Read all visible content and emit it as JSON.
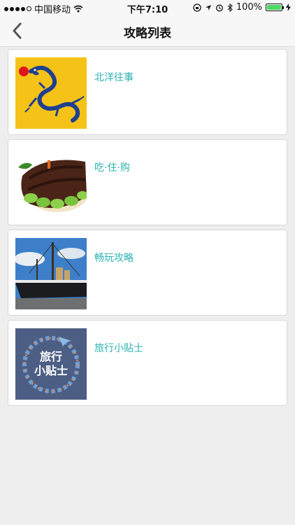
{
  "status_bar": {
    "carrier": "中国移动",
    "time": "下午7:10",
    "battery": "100%",
    "battery_level": 1.0
  },
  "nav": {
    "title": "攻略列表",
    "back_icon": "chevron-left-icon"
  },
  "items": [
    {
      "title": "北洋往事",
      "image": "dragon-flag-image"
    },
    {
      "title": "吃·住·购",
      "image": "food-dish-image"
    },
    {
      "title": "畅玩攻略",
      "image": "warship-image"
    },
    {
      "title": "旅行小贴士",
      "image": "travel-tips-image",
      "image_text_line1": "旅行",
      "image_text_line2": "小贴士"
    }
  ],
  "colors": {
    "accent": "#2cb2b2",
    "background": "#eeeeee",
    "card": "#ffffff"
  }
}
